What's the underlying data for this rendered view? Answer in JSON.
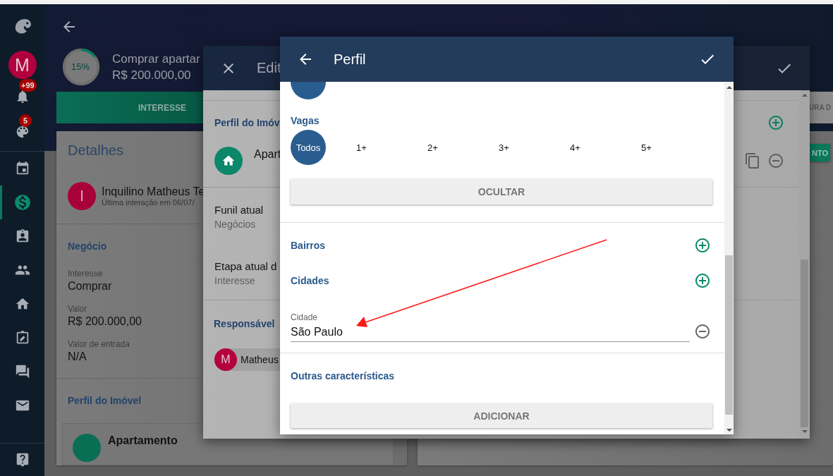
{
  "sidebar": {
    "avatar": "M",
    "alerts": [
      {
        "badge": "+99"
      },
      {
        "badge": "5"
      }
    ],
    "items": [
      {
        "selected": false
      },
      {
        "selected": true
      },
      {
        "selected": false
      },
      {
        "selected": false
      },
      {
        "selected": false
      },
      {
        "selected": false
      },
      {
        "selected": false
      },
      {
        "selected": false
      }
    ]
  },
  "page": {
    "progress": {
      "label": "15%"
    },
    "title": "Comprar apartar",
    "value": "R$ 200.000,00",
    "tabs": [
      {
        "label": "INTERESSE",
        "selected": true
      },
      {
        "label": "URA D",
        "selected": false
      }
    ],
    "details": {
      "title": "Detalhes",
      "contact": {
        "initial": "I",
        "name": "Inquilino Matheus Te",
        "meta": "Última interação em 06/07/"
      },
      "section": "Negócio",
      "fields": [
        {
          "label": "Interesse",
          "value": "Comprar"
        },
        {
          "label": "Valor",
          "value": "R$ 200.000,00"
        },
        {
          "label": "Valor de entrada",
          "value": "N/A"
        }
      ],
      "profile_title": "Perfil do Imóvel",
      "profile_item": "Apartamento"
    },
    "side_button": "NTO"
  },
  "edit_dialog": {
    "title": "Edit",
    "profile_title": "Perfil do Imóv",
    "profile_item": "Apart",
    "fields": [
      {
        "label": "Funil atual",
        "value": "Negócios"
      },
      {
        "label": "Etapa atual d",
        "value": "Interesse"
      }
    ],
    "owner_title": "Responsável",
    "owner": {
      "initial": "M",
      "name": "Matheus"
    }
  },
  "profile_dialog": {
    "title": "Perfil",
    "option_rows": [
      {
        "options": [
          {
            "selected": true
          }
        ]
      },
      {
        "label": "Vagas",
        "options": [
          {
            "label": "Todos",
            "selected": true
          },
          {
            "label": "1+",
            "selected": false
          },
          {
            "label": "2+",
            "selected": false
          },
          {
            "label": "3+",
            "selected": false
          },
          {
            "label": "4+",
            "selected": false
          },
          {
            "label": "5+",
            "selected": false
          }
        ]
      }
    ],
    "hide_button": "OCULTAR",
    "lists": [
      {
        "label": "Bairros"
      },
      {
        "label": "Cidades"
      }
    ],
    "city_field": {
      "label": "Cidade",
      "value": "São Paulo"
    },
    "other_title": "Outras características",
    "add_button": "ADICIONAR"
  }
}
